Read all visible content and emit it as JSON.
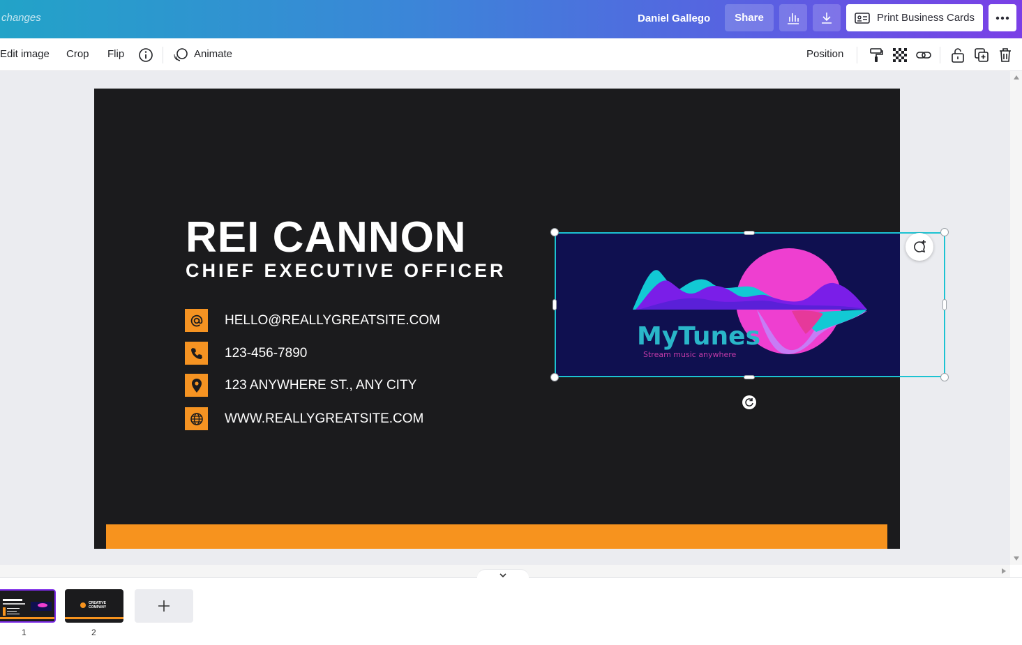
{
  "topbar": {
    "changes_text": "changes",
    "user_name": "Daniel Gallego",
    "share_label": "Share",
    "print_label": "Print Business Cards"
  },
  "toolbar": {
    "edit_image": "Edit image",
    "crop": "Crop",
    "flip": "Flip",
    "animate": "Animate",
    "position": "Position"
  },
  "card": {
    "name": "REI CANNON",
    "title": "CHIEF EXECUTIVE OFFICER",
    "contacts": [
      {
        "icon": "at-icon",
        "text": "HELLO@REALLYGREATSITE.COM"
      },
      {
        "icon": "phone-icon",
        "text": "123-456-7890"
      },
      {
        "icon": "location-pin-icon",
        "text": "123 ANYWHERE ST., ANY CITY"
      },
      {
        "icon": "globe-icon",
        "text": "WWW.REALLYGREATSITE.COM"
      }
    ],
    "logo": {
      "brand": "MyTunes",
      "tagline": "Stream music anywhere"
    }
  },
  "pages": {
    "page1_num": "1",
    "page2_num": "2",
    "thumb2_text_line1": "CREATIVE",
    "thumb2_text_line2": "COMPANY"
  },
  "colors": {
    "accent_orange": "#f7931e",
    "card_bg": "#1b1b1d",
    "selection": "#1cc3d2",
    "logo_bg": "#0f1050"
  }
}
